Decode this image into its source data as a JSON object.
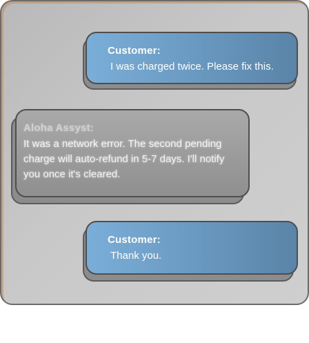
{
  "conversation": {
    "messages": [
      {
        "speaker": "Customer:",
        "text": "I was charged twice. Please fix this."
      },
      {
        "speaker": "Aloha Assyst:",
        "text": "It was a network error. The second pending charge will auto-refund in 5-7 days. I'll notify you once it's cleared."
      },
      {
        "speaker": "Customer:",
        "text": "Thank you."
      }
    ]
  },
  "colors": {
    "customer_bubble": "#6c9cc4",
    "agent_bubble": "#9a9a9a",
    "panel_background": "#c4c4c4",
    "panel_border": "#6b6b6b"
  }
}
